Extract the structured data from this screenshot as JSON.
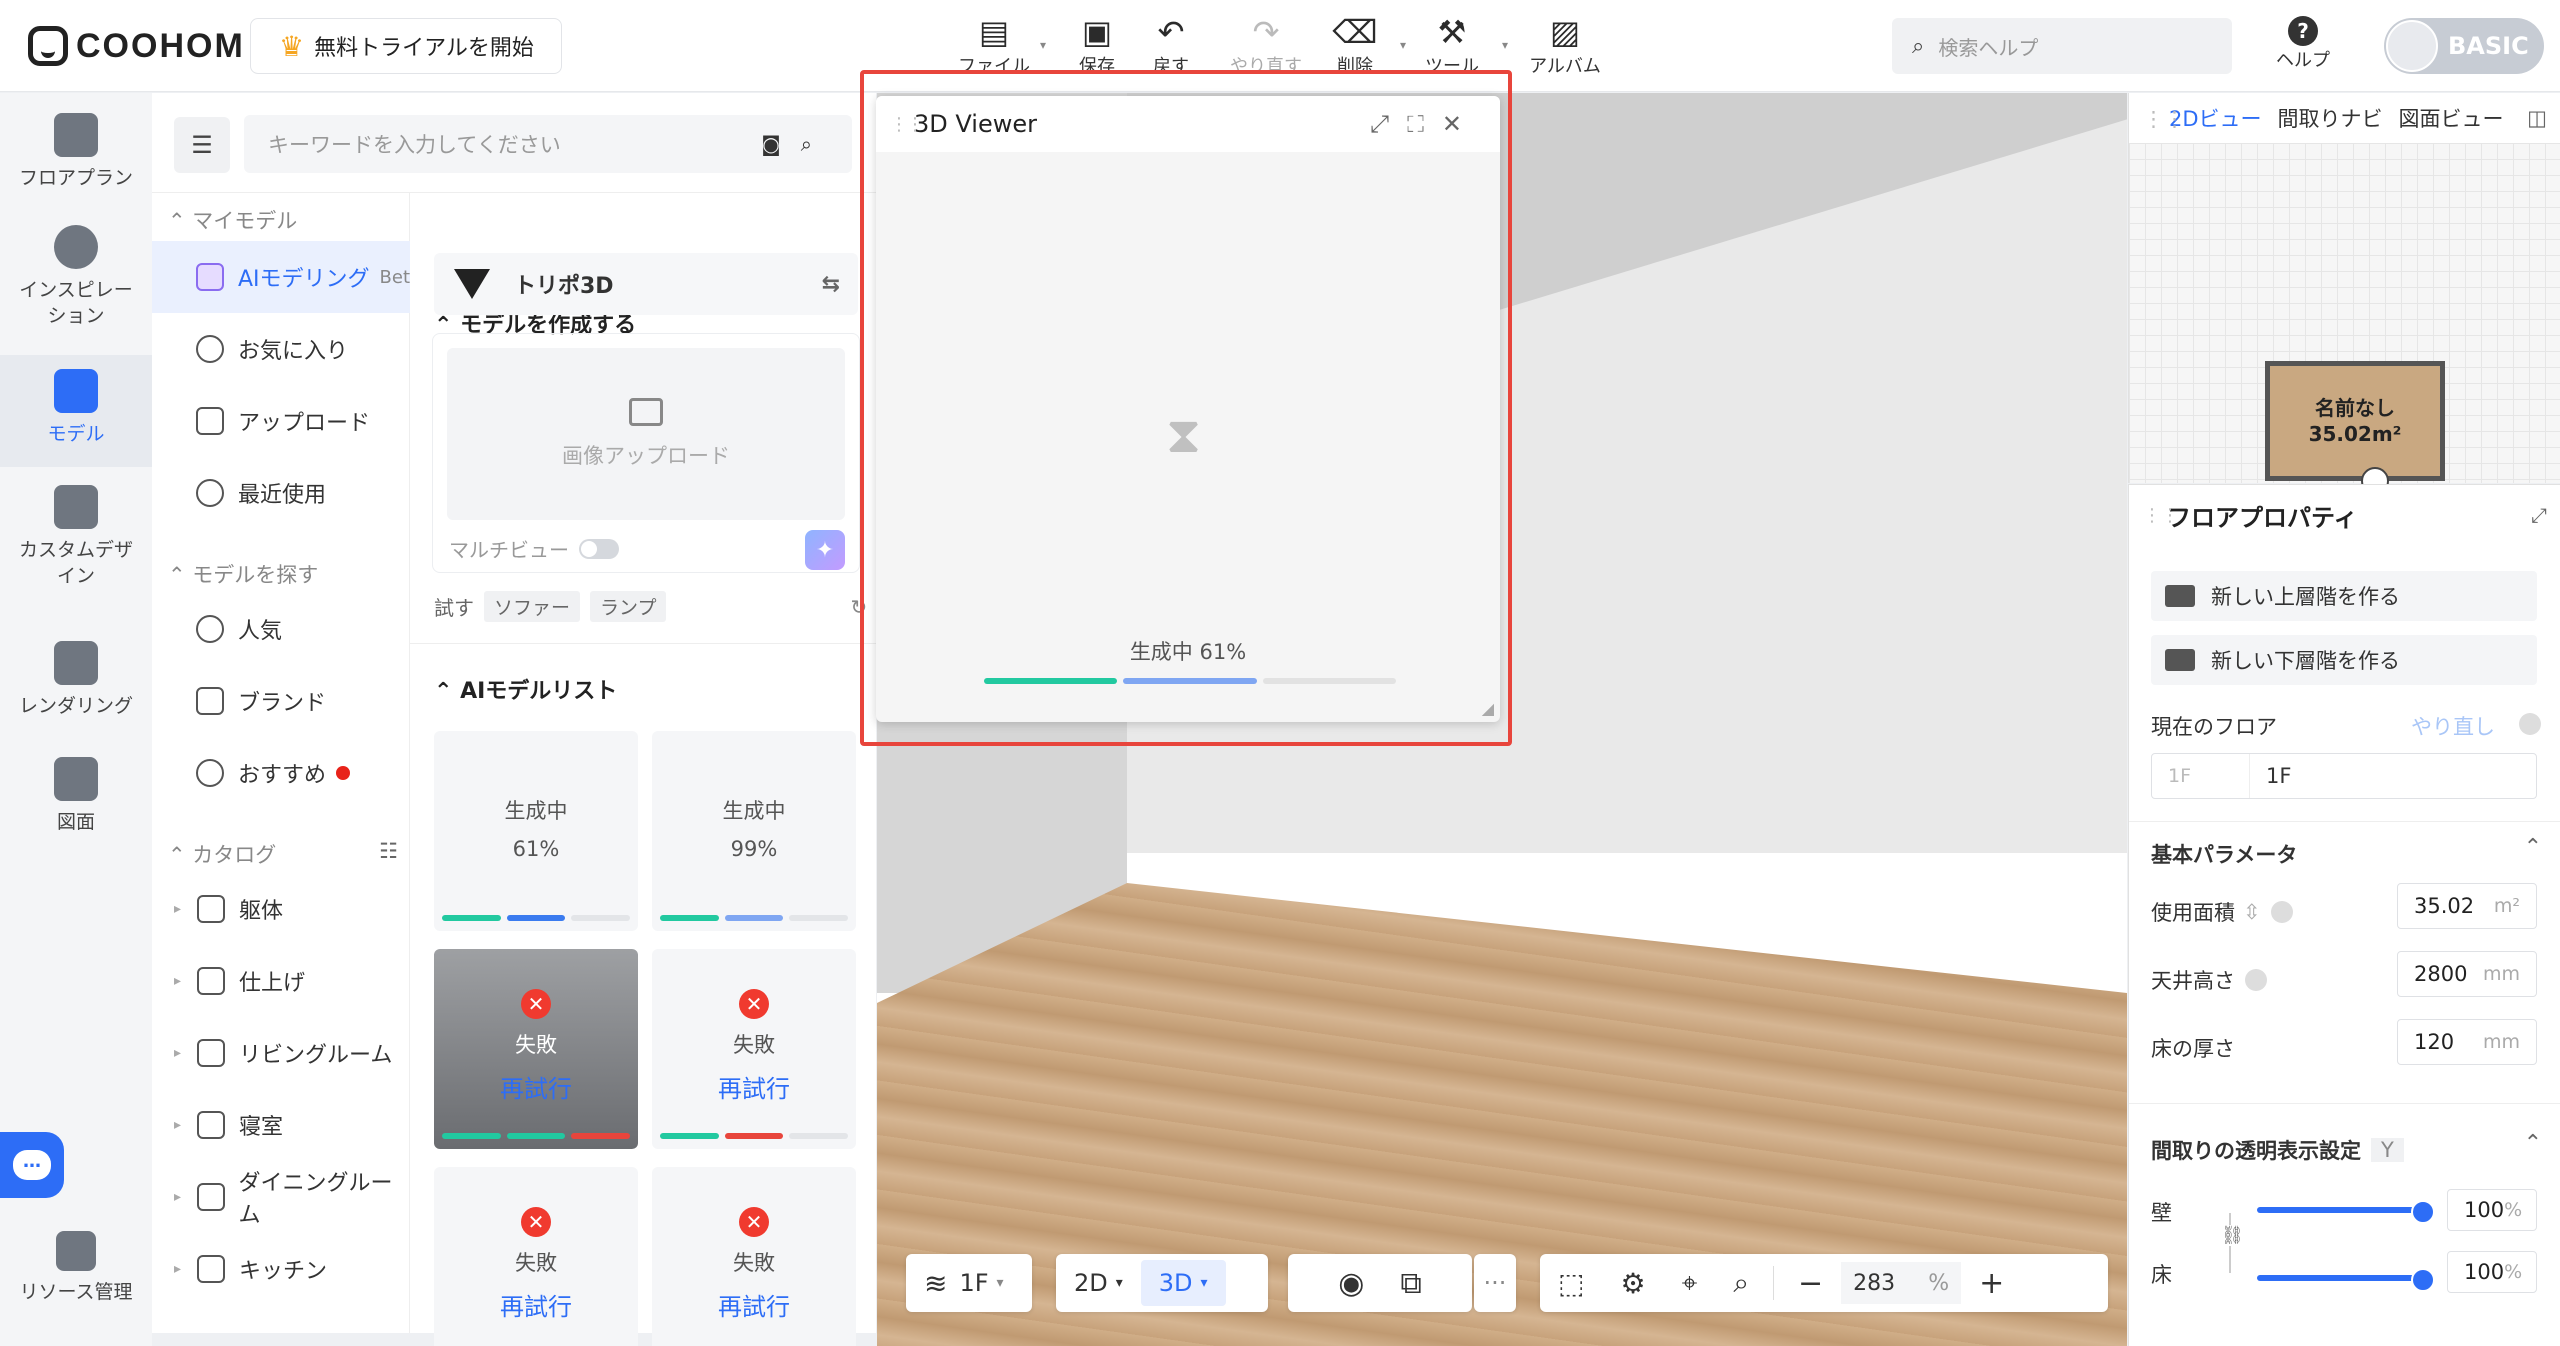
{
  "app": {
    "logo": "COOHOM",
    "trial_button": "無料トライアルを開始"
  },
  "toolbar": {
    "items": [
      {
        "label": "ファイル",
        "icon": "file-icon"
      },
      {
        "label": "保存",
        "icon": "save-icon"
      },
      {
        "label": "戻す",
        "icon": "undo-icon"
      },
      {
        "label": "やり直す",
        "icon": "redo-icon"
      },
      {
        "label": "削除",
        "icon": "eraser-icon"
      },
      {
        "label": "ツール",
        "icon": "wrench-icon"
      },
      {
        "label": "アルバム",
        "icon": "album-icon"
      }
    ],
    "search_placeholder": "検索ヘルプ",
    "help_label": "ヘルプ",
    "plan_badge": "BASIC"
  },
  "rail": {
    "items": [
      {
        "label": "フロアプラン"
      },
      {
        "label": "インスピレー\nション"
      },
      {
        "label": "モデル"
      },
      {
        "label": "カスタムデザ\nイン"
      },
      {
        "label": "レンダリング"
      },
      {
        "label": "図面"
      }
    ],
    "bottom_label": "リソース管理"
  },
  "panel": {
    "keyword_placeholder": "キーワードを入力してください",
    "my_models_header": "マイモデル",
    "my_models": [
      {
        "label": "AIモデリング",
        "suffix": "Bet"
      },
      {
        "label": "お気に入り"
      },
      {
        "label": "アップロード"
      },
      {
        "label": "最近使用"
      }
    ],
    "find_header": "モデルを探す",
    "find_items": [
      {
        "label": "人気"
      },
      {
        "label": "ブランド"
      },
      {
        "label": "おすすめ"
      }
    ],
    "catalog_header": "カタログ",
    "catalog_items": [
      {
        "label": "躯体"
      },
      {
        "label": "仕上げ"
      },
      {
        "label": "リビングルーム"
      },
      {
        "label": "寝室"
      },
      {
        "label": "ダイニングルーム"
      },
      {
        "label": "キッチン"
      }
    ],
    "create_header": "モデルを作成する",
    "provider": "トリポ3D",
    "upload_label": "画像アップロード",
    "multiview_label": "マルチビュー",
    "try_label": "試す",
    "try_tags": [
      "ソファー",
      "ランプ"
    ],
    "ai_list_header": "AIモデルリスト",
    "cards": [
      {
        "status": "生成中",
        "progress_text": "61%",
        "progress": 0.61
      },
      {
        "status": "生成中",
        "progress_text": "99%",
        "progress": 0.99
      },
      {
        "status": "失敗",
        "action": "再試行"
      },
      {
        "status": "失敗",
        "action": "再試行"
      },
      {
        "status": "失敗",
        "action": "再試行"
      },
      {
        "status": "失敗",
        "action": "再試行"
      }
    ]
  },
  "viewer": {
    "title": "3D Viewer",
    "progress_text": "生成中 61%",
    "progress": 0.61
  },
  "bottombar": {
    "floor": "1F",
    "mode_2d": "2D",
    "mode_3d": "3D",
    "more": "···",
    "zoom_value": "283",
    "zoom_unit": "%",
    "minus": "−",
    "plus": "+"
  },
  "nav2d": {
    "tabs": [
      "2Dビュー",
      "間取りナビ",
      "図面ビュー"
    ],
    "room_name": "名前なし",
    "room_area": "35.02m²"
  },
  "props": {
    "title": "フロアプロパティ",
    "btn_upper": "新しい上層階を作る",
    "btn_lower": "新しい下層階を作る",
    "current_floor_label": "現在のフロア",
    "redo_label": "やり直し",
    "floor_select": "1F",
    "floor_value": "1F",
    "basic_params": "基本パラメータ",
    "area_label": "使用面積",
    "area_value": "35.02",
    "area_unit": "m²",
    "ceiling_label": "天井高さ",
    "ceiling_value": "2800",
    "ceiling_unit": "mm",
    "floor_thick_label": "床の厚さ",
    "floor_thick_value": "120",
    "floor_thick_unit": "mm",
    "transparency_label": "間取りの透明表示設定",
    "transparency_key": "Y",
    "wall_label": "壁",
    "wall_value": "100",
    "floor_label": "床",
    "floor_trans_value": "100",
    "pct": "%"
  }
}
